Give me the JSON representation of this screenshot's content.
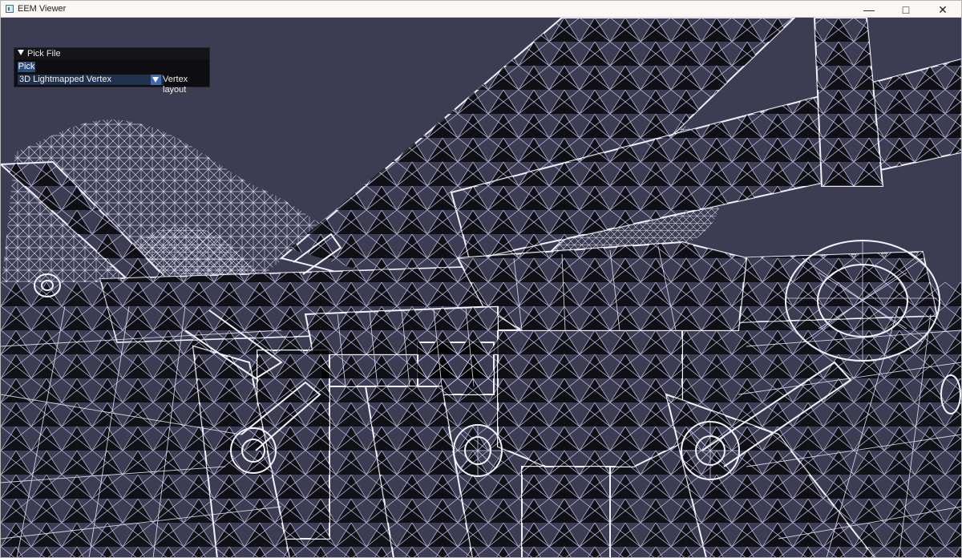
{
  "window": {
    "title": "EEM Viewer",
    "controls": {
      "minimize": "—",
      "maximize": "□",
      "close": "✕"
    }
  },
  "panel": {
    "title": "Pick File",
    "pick_button": "Pick",
    "layout_value": "3D Lightmapped Vertex",
    "layout_label": "Vertex layout"
  },
  "colors": {
    "background": "#3c3d52",
    "wire": "#dfe0ff",
    "panel": "#0d0d12",
    "accent": "#2d4e80"
  }
}
